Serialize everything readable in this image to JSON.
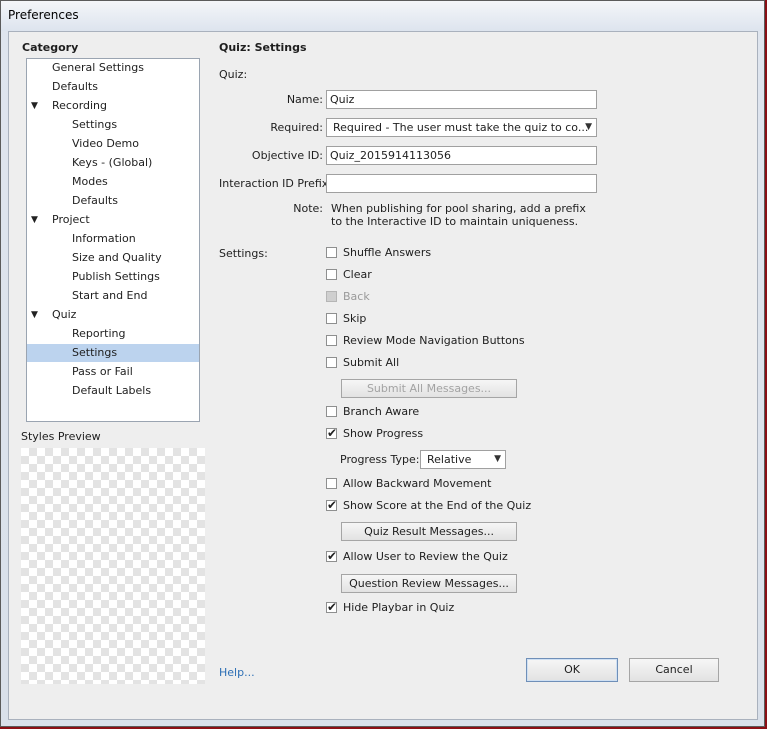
{
  "window": {
    "title": "Preferences"
  },
  "sidebar": {
    "heading": "Category",
    "items": [
      {
        "label": "General Settings",
        "level": 0,
        "expanded": null
      },
      {
        "label": "Defaults",
        "level": 0,
        "expanded": null
      },
      {
        "label": "Recording",
        "level": 0,
        "expanded": true
      },
      {
        "label": "Settings",
        "level": 1,
        "expanded": null
      },
      {
        "label": "Video Demo",
        "level": 1,
        "expanded": null
      },
      {
        "label": "Keys - (Global)",
        "level": 1,
        "expanded": null
      },
      {
        "label": "Modes",
        "level": 1,
        "expanded": null
      },
      {
        "label": "Defaults",
        "level": 1,
        "expanded": null
      },
      {
        "label": "Project",
        "level": 0,
        "expanded": true
      },
      {
        "label": "Information",
        "level": 1,
        "expanded": null
      },
      {
        "label": "Size and Quality",
        "level": 1,
        "expanded": null
      },
      {
        "label": "Publish Settings",
        "level": 1,
        "expanded": null
      },
      {
        "label": "Start and End",
        "level": 1,
        "expanded": null
      },
      {
        "label": "Quiz",
        "level": 0,
        "expanded": true
      },
      {
        "label": "Reporting",
        "level": 1,
        "expanded": null
      },
      {
        "label": "Settings",
        "level": 1,
        "expanded": null,
        "selected": true
      },
      {
        "label": "Pass or Fail",
        "level": 1,
        "expanded": null
      },
      {
        "label": "Default Labels",
        "level": 1,
        "expanded": null
      }
    ],
    "expand_glyph": "▼",
    "styles_preview_label": "Styles Preview"
  },
  "panel": {
    "title": "Quiz: Settings",
    "quiz_section_label": "Quiz:",
    "name": {
      "label": "Name:",
      "value": "Quiz"
    },
    "required": {
      "label": "Required:",
      "value": "Required - The user must take the quiz to co..."
    },
    "objective_id": {
      "label": "Objective ID:",
      "value": "Quiz_2015914113056"
    },
    "interaction_prefix": {
      "label": "Interaction ID Prefix:",
      "value": ""
    },
    "note": {
      "label": "Note:",
      "line1": "When publishing for pool sharing, add a prefix",
      "line2": "to the Interactive ID to maintain uniqueness."
    },
    "settings_label": "Settings:",
    "options": {
      "shuffle_answers": {
        "label": "Shuffle Answers",
        "checked": false
      },
      "clear": {
        "label": "Clear",
        "checked": false
      },
      "back": {
        "label": "Back",
        "checked": false,
        "disabled": true
      },
      "skip": {
        "label": "Skip",
        "checked": false
      },
      "review_mode_nav": {
        "label": "Review Mode Navigation Buttons",
        "checked": false
      },
      "submit_all": {
        "label": "Submit All",
        "checked": false
      },
      "branch_aware": {
        "label": "Branch Aware",
        "checked": false
      },
      "show_progress": {
        "label": "Show Progress",
        "checked": true
      },
      "allow_backward": {
        "label": "Allow Backward Movement",
        "checked": false
      },
      "show_score": {
        "label": "Show Score at the End of the Quiz",
        "checked": true
      },
      "allow_review": {
        "label": "Allow User to Review the Quiz",
        "checked": true
      },
      "hide_playbar": {
        "label": "Hide Playbar in Quiz",
        "checked": true
      }
    },
    "submit_all_messages_button": "Submit All Messages...",
    "progress_type": {
      "label": "Progress Type:",
      "value": "Relative"
    },
    "quiz_result_messages_button": "Quiz Result Messages...",
    "question_review_messages_button": "Question Review Messages...",
    "check_glyph": "✔"
  },
  "footer": {
    "help_link": "Help...",
    "ok_label": "OK",
    "cancel_label": "Cancel"
  },
  "colors": {
    "selection": "#bcd3ee",
    "link": "#2d6fb5",
    "background": "#eeeeee"
  }
}
